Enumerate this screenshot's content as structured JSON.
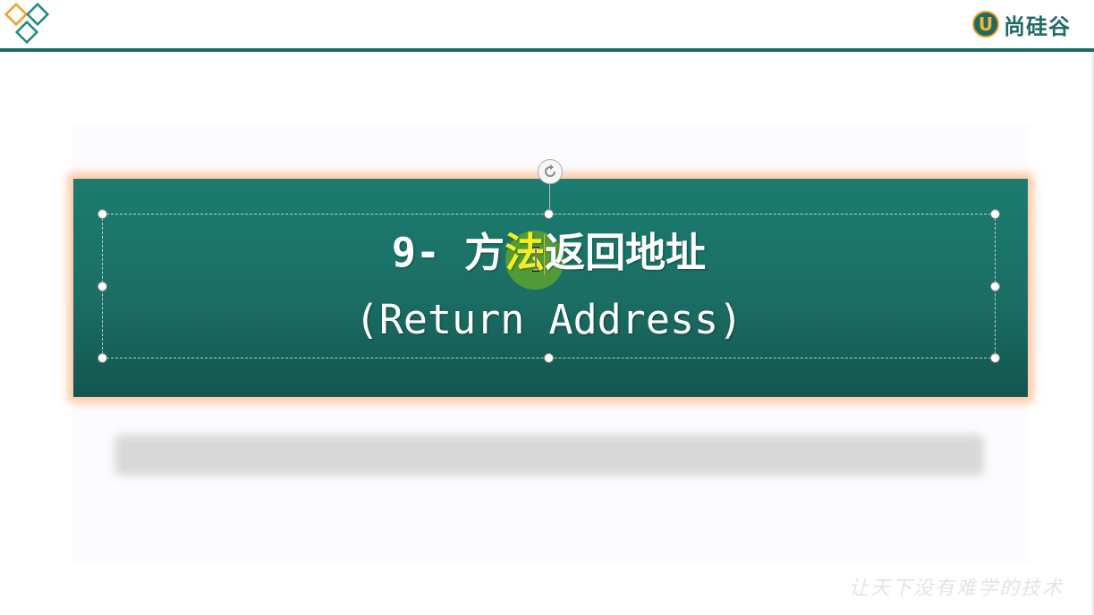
{
  "header": {
    "brand_mark": "U",
    "brand_name": "尚硅谷"
  },
  "slide": {
    "title_num": "9-",
    "title_cn_pre": "方",
    "title_cn_highlight": "法",
    "title_cn_post": "返回地址",
    "subtitle": "(Return Address)",
    "slogan": "让天下没有难学的技术"
  },
  "colors": {
    "banner": "#1b7c70",
    "brand_teal": "#1f6b63",
    "highlight_text": "#f4ef22",
    "banner_glow": "#ff9650"
  },
  "icons": {
    "logo": "diamond-logo-icon",
    "rotate": "rotate-handle-icon",
    "cursor": "text-cursor-icon"
  }
}
